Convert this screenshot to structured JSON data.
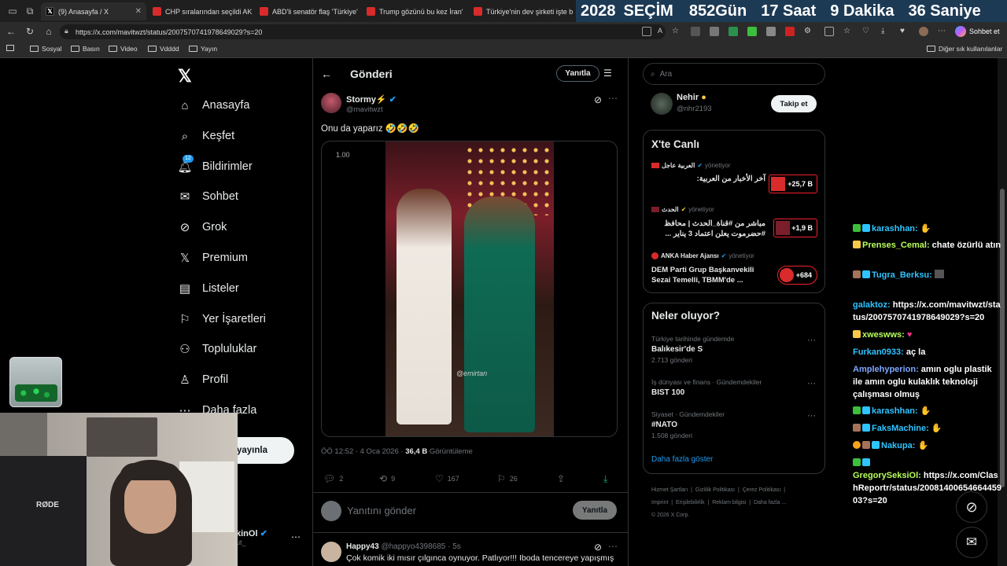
{
  "browser": {
    "tabs": [
      {
        "label": "(9) Anasayfa / X",
        "icon": "x-logo-icon",
        "active": true
      },
      {
        "label": "CHP sıralarından seçildi AK"
      },
      {
        "label": "ABD'li senatör flaş 'Türkiye'"
      },
      {
        "label": "Trump gözünü bu kez İran'"
      },
      {
        "label": "Türkiye'nin dev şirketi işte b"
      }
    ],
    "url": "https://x.com/mavitwzt/status/2007570741978649029?s=20",
    "copilot_label": "Sohbet et",
    "bookmarks": [
      "Sosyal",
      "Basın",
      "Video",
      "Vdddd",
      "Yayın"
    ],
    "other_bookmarks": "Diğer sık kullanılanlar"
  },
  "countdown": {
    "year": "2028",
    "label": "SEÇİM",
    "days": "852",
    "days_unit": "Gün",
    "hours": "17",
    "hours_unit": "Saat",
    "minutes": "9",
    "minutes_unit": "Dakika",
    "seconds": "36",
    "seconds_unit": "Saniye"
  },
  "sidebar": {
    "items": [
      {
        "label": "Anasayfa",
        "icon": "home-icon"
      },
      {
        "label": "Keşfet",
        "icon": "search-icon"
      },
      {
        "label": "Bildirimler",
        "icon": "bell-icon",
        "badge": "12"
      },
      {
        "label": "Sohbet",
        "icon": "mail-icon"
      },
      {
        "label": "Grok",
        "icon": "grok-icon"
      },
      {
        "label": "Premium",
        "icon": "x-logo-icon"
      },
      {
        "label": "Listeler",
        "icon": "list-icon"
      },
      {
        "label": "Yer İşaretleri",
        "icon": "bookmark-icon"
      },
      {
        "label": "Topluluklar",
        "icon": "people-icon"
      },
      {
        "label": "Profil",
        "icon": "person-icon"
      },
      {
        "label": "Daha fazla",
        "icon": "more-icon"
      }
    ],
    "post_button": "yayınla",
    "account_name": "kinOl",
    "account_handle": "ut_"
  },
  "post": {
    "header_title": "Gönderi",
    "reply_pill": "Yanıtla",
    "author_name": "Stormy⚡",
    "author_handle": "@mavitwzt",
    "text": "Onu da yaparız 🤣🤣🤣",
    "video_speed": "1.00",
    "watermark": "@emirtan",
    "time": "ÖÖ 12:52 · 4 Oca 2026 ·",
    "views": "36,4 B",
    "views_label": "Görüntüleme",
    "stats": {
      "replies": "2",
      "reposts": "9",
      "likes": "167",
      "bookmarks": "26"
    },
    "reply_placeholder": "Yanıtını gönder",
    "reply_button": "Yanıtla"
  },
  "next_reply": {
    "name": "Happy43",
    "meta": "@happyo4398685 · 5s",
    "text": "Çok komik iki mısır çılgınca oynuyor. Patlıyor!!! Iboda tencereye yapışmış"
  },
  "right": {
    "search_placeholder": "Ara",
    "follow_suggestion": {
      "name": "Nehir",
      "handle": "@nhr2193",
      "button": "Takip et"
    },
    "live_title": "X'te Canlı",
    "live": [
      {
        "source": "العربية عاجل",
        "status": "yönetiyor",
        "title": "آخر الأخبار من العربية:",
        "count": "+25,7 B"
      },
      {
        "source": "الحدث",
        "status": "yönetiyor",
        "title": "مباشر من #قناة_الحدث | محافظ #حضرموت يعلن اعتماد 3 يناير ...",
        "count": "+1,9 B"
      },
      {
        "source": "ANKA Haber Ajansı",
        "status": "yönetiyor",
        "title": "DEM Parti Grup Başkanvekili Sezai Temelli, TBMM'de ...",
        "count": "+684"
      }
    ],
    "trends_title": "Neler oluyor?",
    "trends": [
      {
        "context": "Türkiye tarihinde gündemde",
        "name": "Balıkesir'de S",
        "count": "2.713 gönderi"
      },
      {
        "context": "İş dünyası ve finans · Gündemdekiler",
        "name": "BIST 100",
        "count": ""
      },
      {
        "context": "Siyaset · Gündemdekiler",
        "name": "#NATO",
        "count": "1.508 gönderi"
      }
    ],
    "show_more": "Daha fazla göster",
    "footer": [
      "Hizmet Şartları",
      "Gizlilik Politikası",
      "Çerez Politikası",
      "Imprint",
      "Erişilebilirlik",
      "Reklam bilgisi",
      "Daha fazla ...",
      "© 2026 X Corp."
    ]
  },
  "chat": [
    {
      "user": "karashhan:",
      "msg": "",
      "color": "#2ec4ff"
    },
    {
      "user": "Prenses_Cemal:",
      "msg": "chate özürlü atın",
      "color": "#b8ff5a"
    },
    {
      "user": "Tugra_Berksu:",
      "msg": "",
      "color": "#2ec4ff"
    },
    {
      "user": "galaktoz:",
      "msg": "https://x.com/mavitwzt/status/2007570741978649029?s=20",
      "color": "#2ec4ff"
    },
    {
      "user": "xweswws:",
      "msg": "",
      "color": "#b8ff5a"
    },
    {
      "user": "Furkan0933:",
      "msg": "aç la",
      "color": "#2ec4ff"
    },
    {
      "user": "Amplehyperion:",
      "msg": "amın oglu plastik ile amın oglu kulaklık teknoloji çalışması olmuş",
      "color": "#7ea7ff"
    },
    {
      "user": "karashhan:",
      "msg": "",
      "color": "#2ec4ff"
    },
    {
      "user": "FaksMachine:",
      "msg": "",
      "color": "#2ec4ff"
    },
    {
      "user": "Nakupa:",
      "msg": "",
      "color": "#2ec4ff"
    },
    {
      "user": "GregorySeksiOl:",
      "msg": "https://x.com/ClashReportr/status/2008140065466445903?s=20",
      "color": "#b8ff5a"
    }
  ]
}
